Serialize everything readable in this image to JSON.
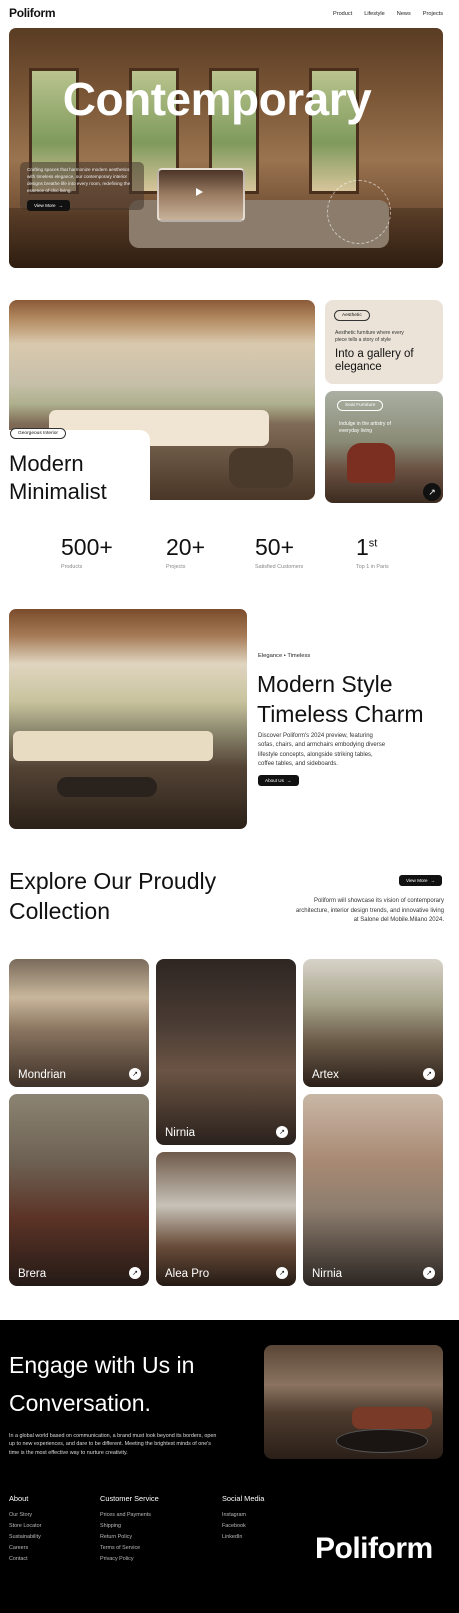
{
  "header": {
    "logo": "Poliform",
    "nav": [
      "Product",
      "Lifestyle",
      "News",
      "Projects"
    ]
  },
  "hero": {
    "title": "Contemporary",
    "description": "Crafting spaces that harmonize modern aesthetics with timeless elegance, our contemporary interior designs breathe life into every room, redefining the essence of chic living.",
    "button": "View More",
    "ring_text": "Modern · Minimalist · Poliform"
  },
  "gallery": {
    "tag": "Georgeous Interior",
    "title_line1": "Modern",
    "title_line2": "Minimalist",
    "aesthetic_tag": "Aesthetic",
    "aesthetic_text": "Aesthetic furniture where every piece tells a story of style",
    "aesthetic_title": "Into a gallery of elegance",
    "seat_tag": "Seat Furniture",
    "seat_text": "Indulge in the artistry of everyday living"
  },
  "stats": [
    {
      "value": "500+",
      "label": "Products"
    },
    {
      "value": "20+",
      "label": "Projects"
    },
    {
      "value": "50+",
      "label": "Satisfied Customers"
    },
    {
      "value": "1",
      "sup": "st",
      "label": "Top 1 in Paris"
    }
  ],
  "modern": {
    "kicker": "Elegance  •  Timeless",
    "title_line1": "Modern Style",
    "title_line2": "Timeless Charm",
    "text": "Discover Poliform's 2024 preview, featuring sofas, chairs, and armchairs embodying diverse lifestyle concepts, alongside striking tables, coffee tables, and sideboards.",
    "button": "About Us"
  },
  "collection": {
    "title_line1": "Explore Our Proudly",
    "title_line2": "Collection",
    "button": "View More",
    "text": "Poliform will showcase its vision of contemporary architecture, interior design trends, and innovative living at Salone del Mobile.Milano 2024.",
    "items": [
      "Mondrian",
      "Nirnia",
      "Artex",
      "Brera",
      "Alea Pro",
      "Nirnia"
    ]
  },
  "footer": {
    "title_line1": "Engage with Us in",
    "title_line2": "Conversation.",
    "text": "In a global world based on communication, a brand must look beyond its borders, open up to new experiences, and dare to be different. Meeting the brightest minds of one's time is the most effective way to nurture creativity.",
    "columns": [
      {
        "heading": "About",
        "links": [
          "Our Story",
          "Store Locator",
          "Sustainability",
          "Careers",
          "Contact"
        ]
      },
      {
        "heading": "Customer Service",
        "links": [
          "Prices and Payments",
          "Shipping",
          "Return Policy",
          "Terms of Service",
          "Privacy Policy"
        ]
      },
      {
        "heading": "Social Media",
        "links": [
          "Instagram",
          "Facebook",
          "LinkedIn"
        ]
      }
    ],
    "logo": "Poliform"
  },
  "colors": {
    "dark": "#111111",
    "beige": "#ebe3d8",
    "footer_bg": "#000000"
  }
}
